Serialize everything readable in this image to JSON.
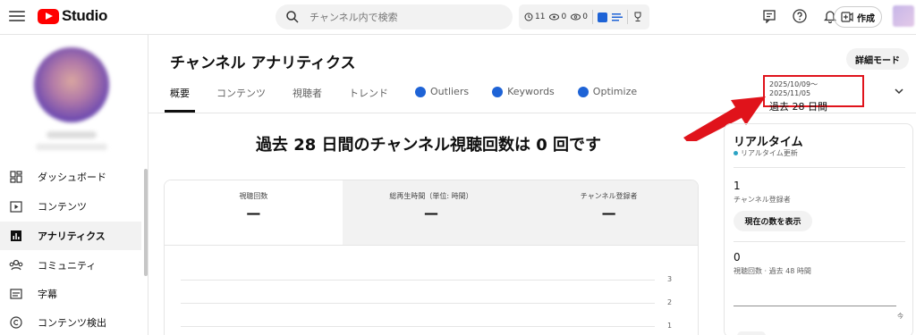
{
  "topbar": {
    "logo_text": "Studio",
    "search_placeholder": "チャンネル内で検索",
    "ext": {
      "stat1": "11",
      "stat2": "0",
      "stat3": "0"
    },
    "create_label": "作成"
  },
  "sidebar": {
    "items": [
      {
        "label": "ダッシュボード",
        "icon": "dashboard-icon"
      },
      {
        "label": "コンテンツ",
        "icon": "content-icon"
      },
      {
        "label": "アナリティクス",
        "icon": "analytics-icon"
      },
      {
        "label": "コミュニティ",
        "icon": "community-icon"
      },
      {
        "label": "字幕",
        "icon": "subtitles-icon"
      },
      {
        "label": "コンテンツ検出",
        "icon": "copyright-icon"
      }
    ]
  },
  "main": {
    "title": "チャンネル アナリティクス",
    "detail_mode": "詳細モード",
    "tabs": [
      "概要",
      "コンテンツ",
      "視聴者",
      "トレンド",
      "Outliers",
      "Keywords",
      "Optimize"
    ],
    "date_range": "2025/10/09～2025/11/05",
    "date_label": "過去 28 日間",
    "headline": "過去 28 日間のチャンネル視聴回数は 0 回です",
    "metrics": [
      {
        "label": "視聴回数",
        "value": "—"
      },
      {
        "label": "総再生時間（単位: 時間）",
        "value": "—"
      },
      {
        "label": "チャンネル登録者",
        "value": "—"
      }
    ],
    "yticks": [
      "3",
      "2",
      "1"
    ]
  },
  "realtime": {
    "title": "リアルタイム",
    "subtitle": "リアルタイム更新",
    "subs_value": "1",
    "subs_label": "チャンネル登録者",
    "show_count": "現在の数を表示",
    "views_value": "0",
    "views_label": "視聴回数 · 過去 48 時間",
    "now_label": "今"
  },
  "colors": {
    "accent": "#ff0000",
    "highlight_border": "#e0131b",
    "arrow": "#e0131b",
    "badge_blue": "#1e63d6"
  }
}
